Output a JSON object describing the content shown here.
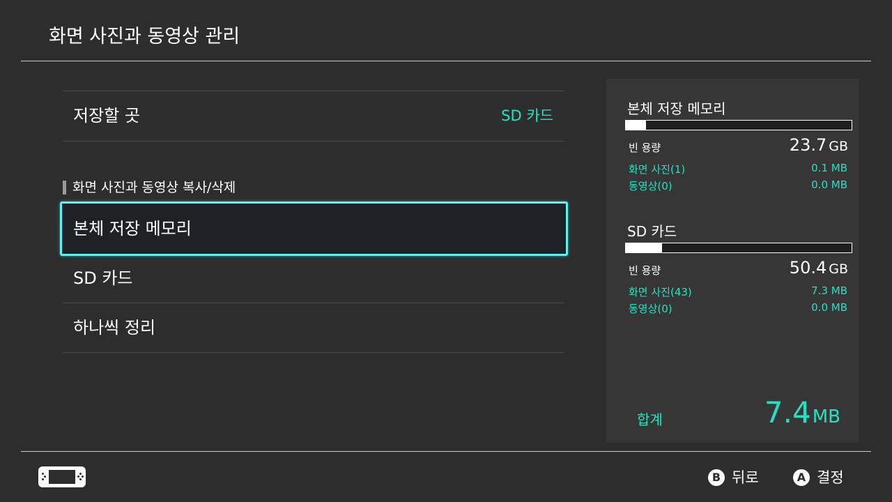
{
  "header": {
    "title": "화면 사진과 동영상 관리"
  },
  "save_location": {
    "label": "저장할 곳",
    "value": "SD 카드"
  },
  "section": {
    "title": "화면 사진과 동영상 복사/삭제"
  },
  "menu": [
    {
      "label": "본체 저장 메모리",
      "selected": true
    },
    {
      "label": "SD 카드",
      "selected": false
    },
    {
      "label": "하나씩 정리",
      "selected": false
    }
  ],
  "storage": {
    "internal": {
      "title": "본체 저장 메모리",
      "usage_fraction": 0.09,
      "free_label": "빈 용량",
      "free_value": "23.7",
      "free_unit": "GB",
      "photos_label": "화면 사진(1)",
      "photos_value": "0.1 MB",
      "videos_label": "동영상(0)",
      "videos_value": "0.0 MB"
    },
    "sd": {
      "title": "SD 카드",
      "usage_fraction": 0.16,
      "free_label": "빈 용량",
      "free_value": "50.4",
      "free_unit": "GB",
      "photos_label": "화면 사진(43)",
      "photos_value": "7.3 MB",
      "videos_label": "동영상(0)",
      "videos_value": "0.0 MB"
    },
    "total": {
      "label": "합계",
      "value": "7.4",
      "unit": "MB"
    }
  },
  "footer": {
    "device_icon": "console-handheld-icon",
    "back": {
      "button": "B",
      "label": "뒤로"
    },
    "confirm": {
      "button": "A",
      "label": "결정"
    }
  },
  "colors": {
    "accent": "#21e3c4",
    "selection_border": "#5ff2f2",
    "background": "#2d2d2d"
  }
}
